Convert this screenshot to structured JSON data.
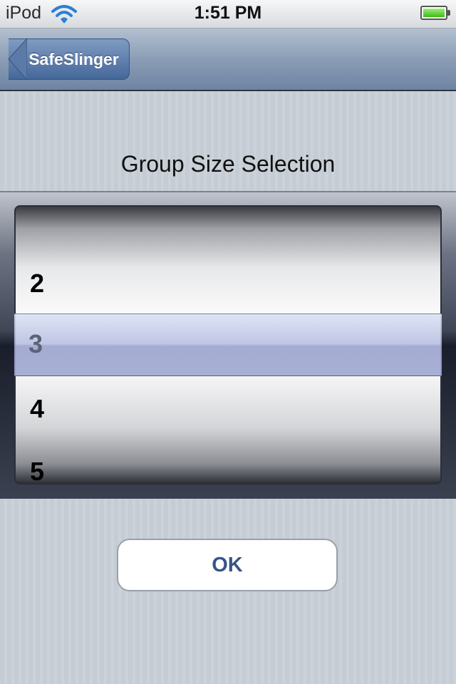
{
  "status_bar": {
    "carrier": "iPod",
    "time": "1:51 PM"
  },
  "nav_bar": {
    "back_label": "SafeSlinger"
  },
  "main": {
    "title": "Group Size Selection",
    "picker": {
      "items_above": [
        "2"
      ],
      "selected": "3",
      "items_below": [
        "4",
        "5"
      ]
    },
    "ok_label": "OK"
  },
  "colors": {
    "nav_tint": "#6d84a2",
    "ok_text": "#385487",
    "battery": "#3cba15"
  }
}
